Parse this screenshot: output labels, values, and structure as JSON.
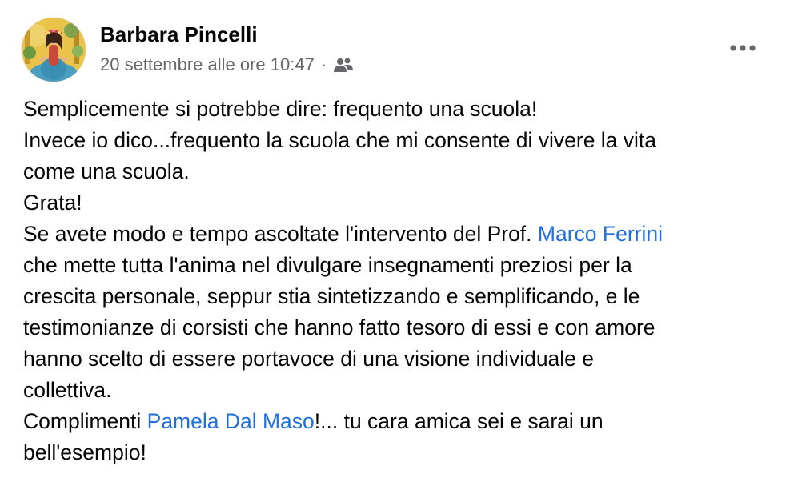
{
  "post": {
    "author": "Barbara Pincelli",
    "timestamp": "20 settembre alle ore 10:47",
    "separator": "·",
    "audience_icon": "friends-icon",
    "more_icon": "more-options-icon",
    "text": {
      "l1": "Semplicemente si potrebbe dire: frequento una scuola!",
      "l2": "Invece io dico...frequento la scuola che mi consente di vivere la vita",
      "l3": "come una scuola.",
      "l4": "Grata!",
      "l5_before": "Se avete modo e tempo ascoltate l'intervento del Prof. ",
      "mention1": "Marco Ferrini",
      "l6": "che mette tutta l'anima nel divulgare insegnamenti preziosi per la",
      "l7": "crescita personale, seppur stia sintetizzando e semplificando, e le",
      "l8": "testimonianze di corsisti che hanno fatto tesoro di essi e con amore",
      "l9": "hanno scelto di essere portavoce di una visione individuale e",
      "l10": "collettiva.",
      "l11_before": "Complimenti ",
      "mention2": "Pamela Dal Maso",
      "l11_after": "!... tu cara amica sei e sarai un",
      "l12": "bell'esempio!"
    }
  },
  "colors": {
    "text": "#050505",
    "secondary": "#65676b",
    "link": "#216fdb"
  }
}
